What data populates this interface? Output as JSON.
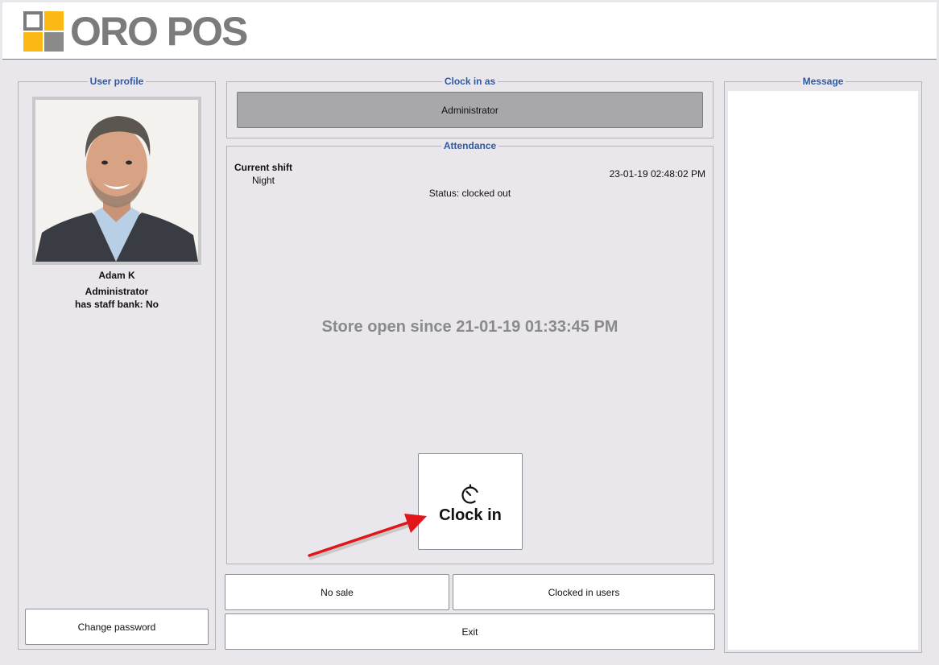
{
  "app": {
    "logo_text": "ORO POS",
    "colors": {
      "accent": "#2e5aa4",
      "logo_yellow": "#fdb913",
      "logo_gray": "#7b7b7b"
    }
  },
  "user_profile": {
    "legend": "User profile",
    "name": "Adam K",
    "role": "Administrator",
    "staff_bank": "has staff bank: No",
    "change_password_label": "Change password"
  },
  "clock_in_as": {
    "legend": "Clock in as",
    "role_button_label": "Administrator"
  },
  "attendance": {
    "legend": "Attendance",
    "current_shift_label": "Current shift",
    "shift_name": "Night",
    "datetime": "23-01-19 02:48:02 PM",
    "status": "Status: clocked out",
    "store_open": "Store open since  21-01-19 01:33:45 PM",
    "clock_in_label": "Clock in",
    "clock_in_icon": "stopwatch-icon"
  },
  "actions": {
    "no_sale_label": "No sale",
    "clocked_in_users_label": "Clocked in users",
    "exit_label": "Exit"
  },
  "message": {
    "legend": "Message"
  }
}
